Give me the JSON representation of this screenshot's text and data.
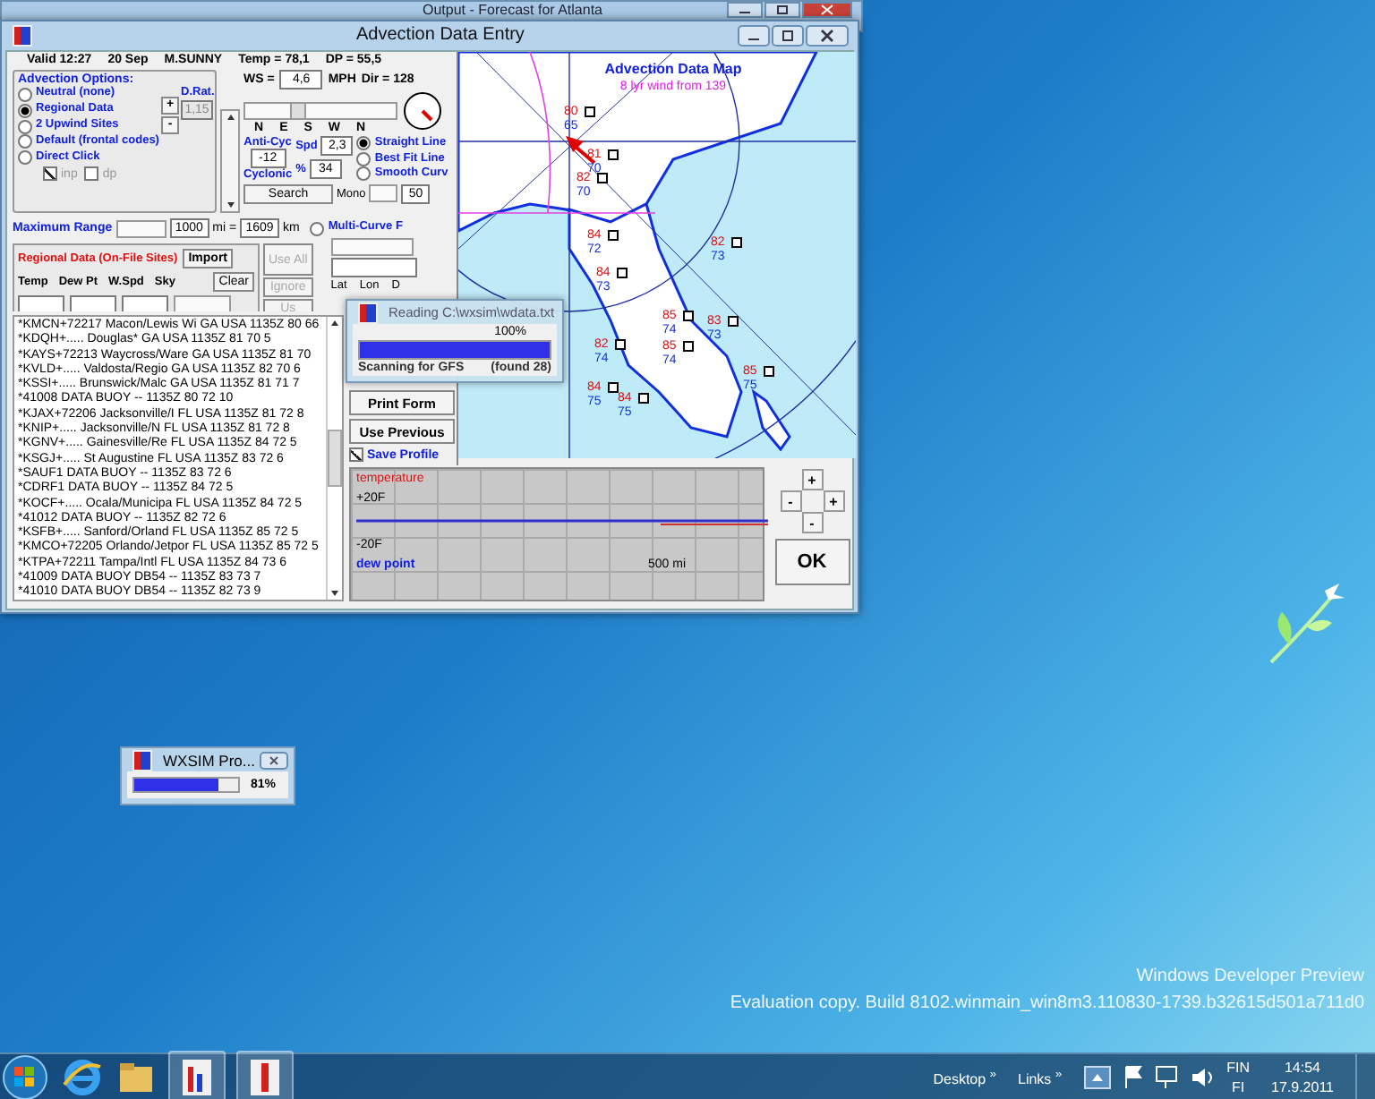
{
  "desktop": {
    "watermark": [
      "Windows Developer Preview",
      "Evaluation copy. Build 8102.winmain_win8m3.110830-1739.b32615d501a711d0"
    ]
  },
  "back_window": {
    "title": "Output - Forecast for Atlanta"
  },
  "window": {
    "title": "Advection Data Entry",
    "header": [
      "Valid 12:27",
      "20 Sep",
      "M.SUNNY",
      "Temp = 78,1",
      "DP = 55,5"
    ],
    "wind": {
      "label": "WS =",
      "value": "4,6",
      "unit": "MPH",
      "dir": "Dir = 128",
      "level": 0.3
    },
    "compass_labels": [
      "N",
      "E",
      "S",
      "W",
      "N"
    ],
    "advection_options": {
      "title": "Advection Options:",
      "options": [
        {
          "label": "Neutral (none)",
          "selected": false
        },
        {
          "label": "Regional Data",
          "selected": true
        },
        {
          "label": "2 Upwind Sites",
          "selected": false
        },
        {
          "label": "Default (frontal codes)",
          "selected": false
        },
        {
          "label": "Direct Click",
          "selected": false
        }
      ],
      "plus": "+",
      "minus": "-",
      "d_rat_label": "D.Rat.",
      "d_rat_value": "1,15",
      "checks": [
        {
          "label": "inp",
          "checked": true
        },
        {
          "label": "dp",
          "checked": false
        }
      ]
    },
    "cyclonic": {
      "anti": "Anti-Cyc",
      "value": "-12",
      "cyc": "Cyclonic",
      "spd_label": "Spd",
      "spd": "2,3",
      "pct_label": "%",
      "pct": "34",
      "search": "Search"
    },
    "fit": {
      "options": [
        {
          "label": "Straight Line",
          "selected": true
        },
        {
          "label": "Best Fit Line",
          "selected": false
        },
        {
          "label": "Smooth Curv",
          "selected": false
        },
        {
          "label": "Multi-Curve F",
          "selected": false
        }
      ],
      "mono_label": "Mono",
      "mono_value": "50"
    },
    "range": {
      "label": "Maximum Range",
      "mi": "1000",
      "eq": "mi =",
      "km": "1609",
      "km_unit": "km"
    },
    "regional": {
      "title": "Regional Data (On-File Sites)",
      "buttons": [
        {
          "label": "Import",
          "disabled": false
        },
        {
          "label": "Use All",
          "disabled": true
        },
        {
          "label": "Clear",
          "disabled": false
        },
        {
          "label": "Ignore",
          "disabled": true
        },
        {
          "label": "Us",
          "disabled": true
        }
      ],
      "columns": [
        "Temp",
        "Dew Pt",
        "W.Spd",
        "Sky"
      ]
    },
    "site_columns": [
      "Lat",
      "Lon",
      "D"
    ],
    "sites": [
      "*KMCN+72217 Macon/Lewis Wi GA USA 1135Z 80 66",
      "*KDQH+..... Douglas* GA USA 1135Z 81 70 5",
      "*KAYS+72213 Waycross/Ware GA USA 1135Z 81 70",
      "*KVLD+..... Valdosta/Regio GA USA 1135Z 82 70 6",
      "*KSSI+..... Brunswick/Malc GA USA 1135Z 81 71 7",
      "*41008 DATA BUOY -- 1135Z 80 72 10",
      "*KJAX+72206 Jacksonville/I FL USA 1135Z 81 72 8",
      "*KNIP+..... Jacksonville/N FL USA 1135Z 81 72 8",
      "*KGNV+..... Gainesville/Re FL USA 1135Z 84 72 5",
      "*KSGJ+..... St Augustine FL USA 1135Z 83 72 6",
      "*SAUF1 DATA BUOY -- 1135Z 83 72 6",
      "*CDRF1 DATA BUOY -- 1135Z 84 72 5",
      "*KOCF+..... Ocala/Municipa FL USA 1135Z 84 72 5",
      "*41012 DATA BUOY -- 1135Z 82 72 6",
      "*KSFB+..... Sanford/Orland FL USA 1135Z 85 72 5",
      "*KMCO+72205 Orlando/Jetpor FL USA 1135Z 85 72 5",
      "*KTPA+72211 Tampa/Intl FL USA 1135Z 84 73 6",
      "*41009 DATA BUOY DB54 -- 1135Z 83 73 7",
      "*41010 DATA BUOY DB54 -- 1135Z 82 73 9"
    ],
    "buttons": {
      "print": "Print Form",
      "previous": "Use Previous",
      "save": {
        "label": "Save Profile",
        "checked": true
      }
    },
    "map": {
      "title": "Advection Data Map",
      "subtitle": "8 lyr wind from 139",
      "stations": [
        {
          "temp": "80",
          "dew": "65"
        },
        {
          "temp": "81",
          "dew": "70"
        },
        {
          "temp": "82",
          "dew": "70"
        },
        {
          "temp": "84",
          "dew": "72"
        },
        {
          "temp": "82",
          "dew": "73"
        },
        {
          "temp": "84",
          "dew": "73"
        },
        {
          "temp": "82",
          "dew": "74"
        },
        {
          "temp": "83",
          "dew": "73"
        },
        {
          "temp": "85",
          "dew": "74"
        },
        {
          "temp": "85",
          "dew": "74"
        },
        {
          "temp": "84",
          "dew": "75"
        },
        {
          "temp": "84",
          "dew": "75"
        },
        {
          "temp": "85",
          "dew": "75"
        }
      ]
    },
    "graph": {
      "temp_label": "temperature",
      "top": "+20F",
      "bottom": "-20F",
      "dew_label": "dew point",
      "scale": "500 mi"
    },
    "zoom_pad": [
      "+",
      "-",
      "+",
      "-"
    ],
    "ok": "OK"
  },
  "reading_dialog": {
    "title": "Reading C:\\wxsim\\wdata.txt",
    "percent": "100%",
    "level": 1,
    "status": "Scanning for GFS",
    "found": "(found 28)"
  },
  "progress_window": {
    "title": "WXSIM Pro...",
    "level": 0.81,
    "percent": "81%"
  },
  "taskbar": {
    "toolbars": [
      {
        "label": "Desktop",
        "chevron": "»"
      },
      {
        "label": "Links",
        "chevron": "»"
      }
    ],
    "lang": "FIN",
    "locale": "FI",
    "time": "14:54",
    "date": "17.9.2011"
  }
}
